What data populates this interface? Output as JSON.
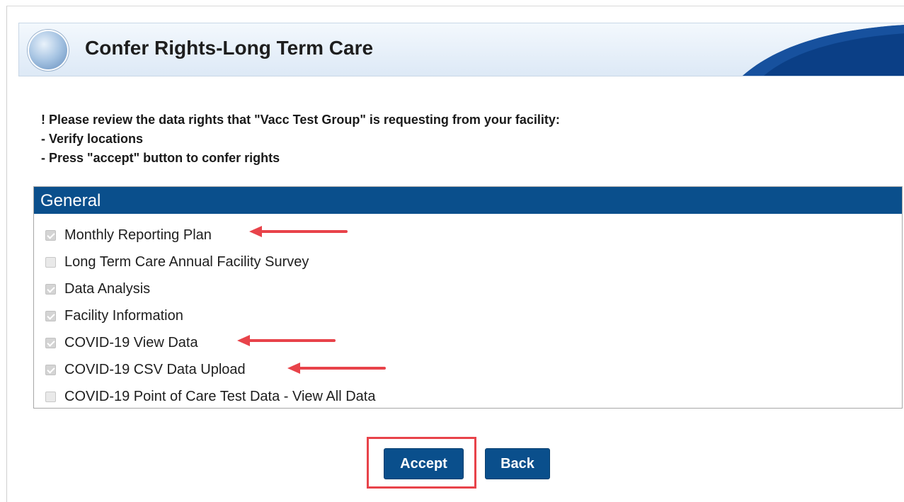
{
  "header": {
    "title": "Confer Rights-Long Term Care",
    "logo": "facility-logo-icon"
  },
  "instructions": {
    "line1": "! Please review the data rights that \"Vacc Test Group\" is requesting from your facility:",
    "line2": " - Verify locations",
    "line3": " - Press \"accept\" button to confer rights"
  },
  "section": {
    "title": "General",
    "items": [
      {
        "label": "Monthly Reporting Plan",
        "checked": true,
        "annotated": true
      },
      {
        "label": "Long Term Care Annual Facility Survey",
        "checked": false,
        "annotated": false
      },
      {
        "label": "Data Analysis",
        "checked": true,
        "annotated": false
      },
      {
        "label": "Facility Information",
        "checked": true,
        "annotated": false
      },
      {
        "label": "COVID-19 View Data",
        "checked": true,
        "annotated": true
      },
      {
        "label": "COVID-19 CSV Data Upload",
        "checked": true,
        "annotated": true
      },
      {
        "label": "COVID-19 Point of Care Test Data - View All Data",
        "checked": false,
        "annotated": false
      }
    ]
  },
  "buttons": {
    "accept": "Accept",
    "back": "Back"
  },
  "colors": {
    "primary": "#0a4f8c",
    "annotation": "#e8434a"
  }
}
